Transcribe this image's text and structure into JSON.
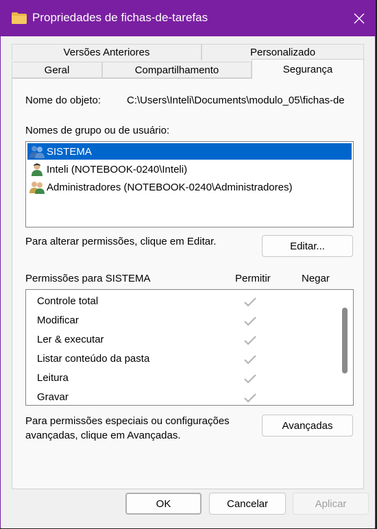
{
  "window": {
    "title": "Propriedades de fichas-de-tarefas"
  },
  "tabs": [
    {
      "label": "Versões Anteriores"
    },
    {
      "label": "Personalizado"
    },
    {
      "label": "Geral"
    },
    {
      "label": "Compartilhamento"
    },
    {
      "label": "Segurança"
    }
  ],
  "object": {
    "label": "Nome do objeto:",
    "value": "C:\\Users\\Inteli\\Documents\\modulo_05\\fichas-de"
  },
  "groups": {
    "label": "Nomes de grupo ou de usuário:",
    "items": [
      {
        "name": "SISTEMA",
        "icon": "group-users-icon"
      },
      {
        "name": "Inteli (NOTEBOOK-0240\\Inteli)",
        "icon": "user-icon"
      },
      {
        "name": "Administradores (NOTEBOOK-0240\\Administradores)",
        "icon": "admin-users-icon"
      }
    ]
  },
  "edit": {
    "hint": "Para alterar permissões, clique em Editar.",
    "button": "Editar..."
  },
  "permissions": {
    "title": "Permissões para SISTEMA",
    "allow_header": "Permitir",
    "deny_header": "Negar",
    "rows": [
      {
        "name": "Controle total",
        "allow": true,
        "deny": false
      },
      {
        "name": "Modificar",
        "allow": true,
        "deny": false
      },
      {
        "name": "Ler & executar",
        "allow": true,
        "deny": false
      },
      {
        "name": "Listar conteúdo da pasta",
        "allow": true,
        "deny": false
      },
      {
        "name": "Leitura",
        "allow": true,
        "deny": false
      },
      {
        "name": "Gravar",
        "allow": true,
        "deny": false
      }
    ]
  },
  "advanced": {
    "hint_line1": "Para permissões especiais ou configurações",
    "hint_line2": "avançadas, clique em Avançadas.",
    "button": "Avançadas"
  },
  "footer": {
    "ok": "OK",
    "cancel": "Cancelar",
    "apply": "Aplicar"
  },
  "colors": {
    "titlebar": "#7a1fa2",
    "selection": "#0066cc",
    "check_disabled": "#b5b5b5"
  }
}
